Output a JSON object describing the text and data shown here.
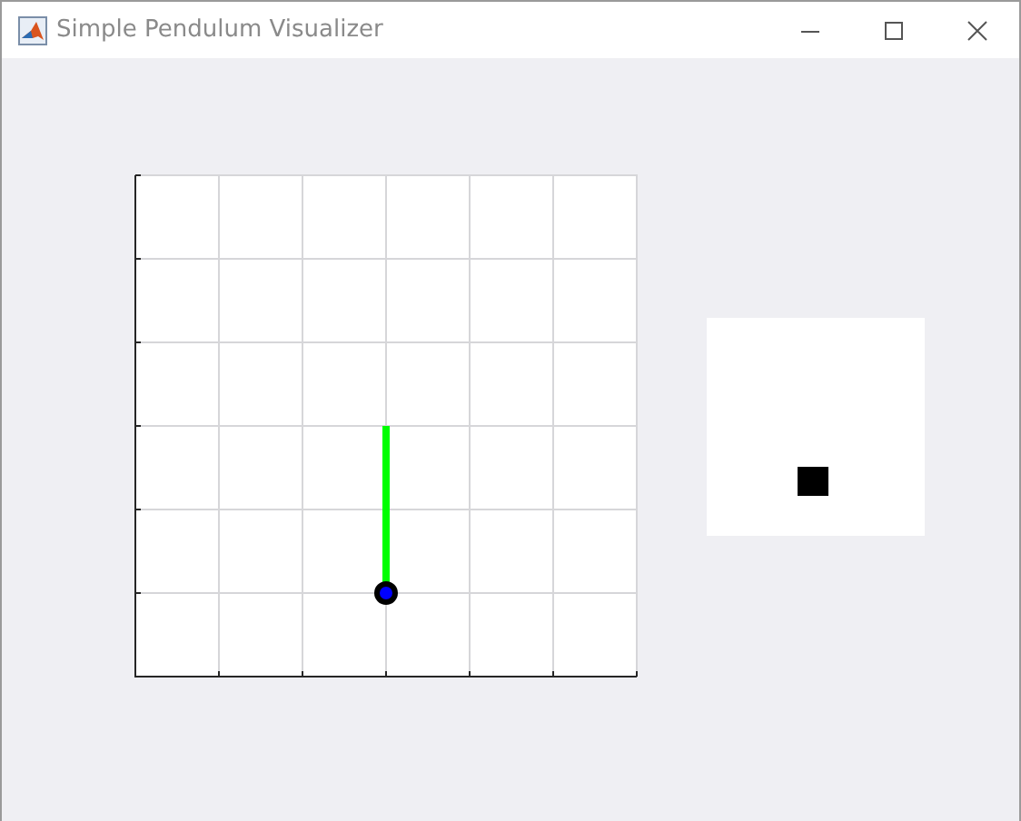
{
  "window": {
    "title": "Simple Pendulum Visualizer"
  }
}
